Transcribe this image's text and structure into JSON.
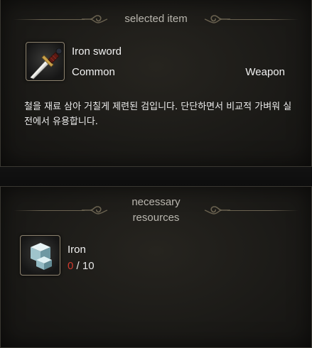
{
  "selected_section": {
    "title": "selected item",
    "item": {
      "name": "Iron sword",
      "rarity": "Common",
      "type": "Weapon",
      "icon": "sword-icon",
      "description": "철을 재료 삼아 거칠게 제련된 검입니다. 단단하면서 비교적 가벼워 실전에서 유용합니다."
    }
  },
  "resources_section": {
    "title_line1": "necessary",
    "title_line2": "resources",
    "resources": [
      {
        "name": "Iron",
        "icon": "iron-block-icon",
        "have": "0",
        "separator": " / ",
        "need": "10"
      }
    ]
  },
  "colors": {
    "background": "#1b1a17",
    "border": "#3a3832",
    "ornament": "#6a6250",
    "insufficient": "#d23a2e",
    "text": "#f2f2f2"
  }
}
